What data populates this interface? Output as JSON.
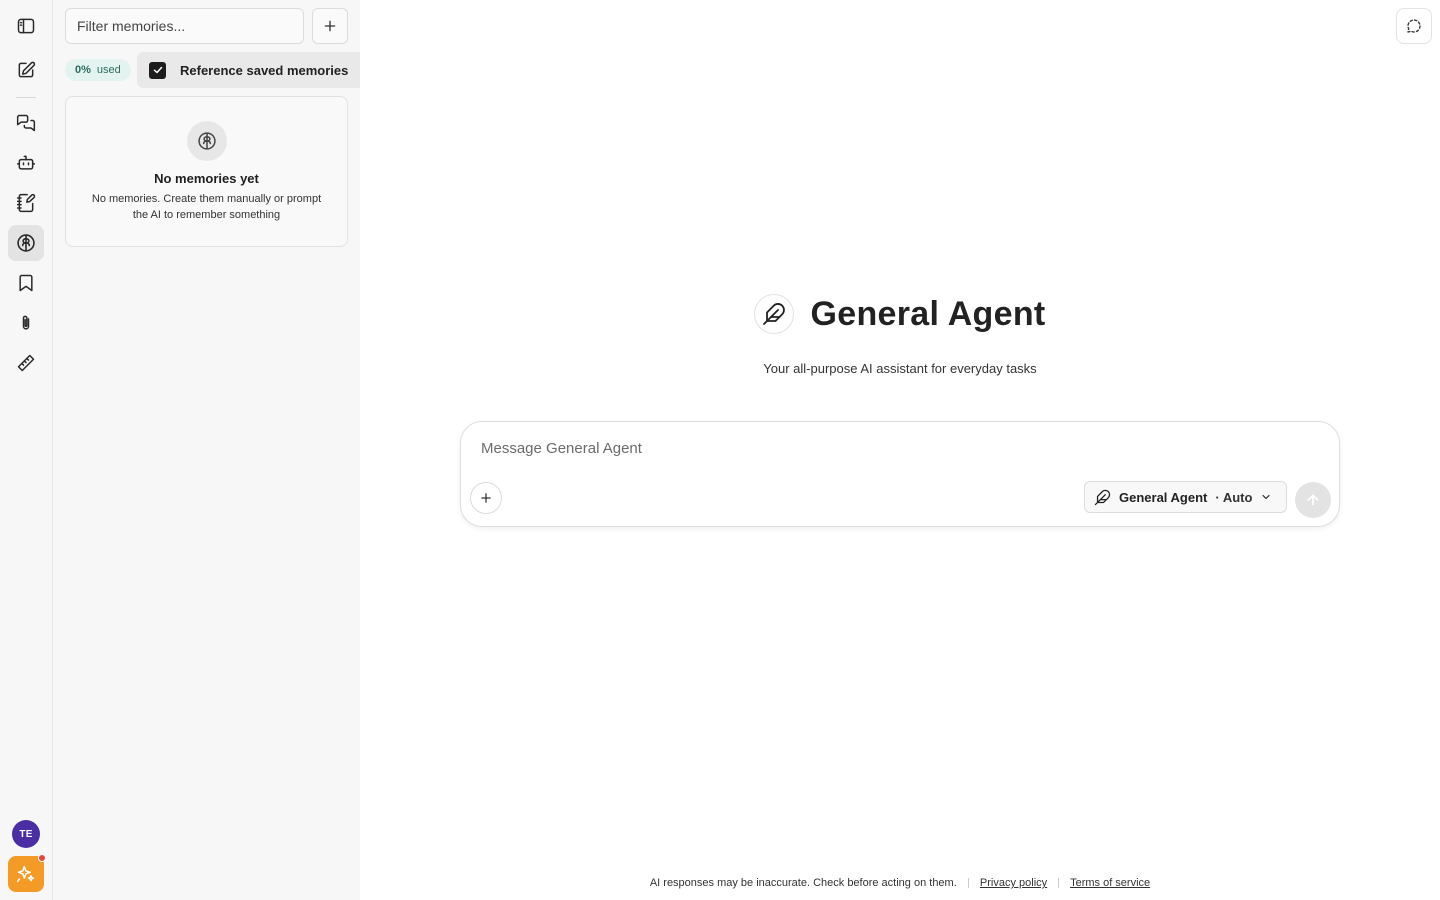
{
  "rail": {
    "items": [
      {
        "icon": "sidebar-toggle-icon"
      },
      {
        "icon": "new-chat-icon"
      },
      {
        "icon": "chats-icon"
      },
      {
        "icon": "bot-icon"
      },
      {
        "icon": "notebook-icon"
      },
      {
        "icon": "brain-icon",
        "active": true
      },
      {
        "icon": "bookmark-icon"
      },
      {
        "icon": "paperclip-icon"
      },
      {
        "icon": "ruler-icon"
      }
    ],
    "avatar_initials": "TE"
  },
  "memories": {
    "filter_placeholder": "Filter memories...",
    "usage_percent": "0%",
    "usage_label": "used",
    "reference_label": "Reference saved memories",
    "reference_checked": true,
    "empty_title": "No memories yet",
    "empty_description": "No memories. Create them manually or prompt the AI to remember something"
  },
  "main": {
    "agent_title": "General Agent",
    "agent_subtitle": "Your all-purpose AI assistant for everyday tasks",
    "composer_placeholder": "Message General Agent",
    "agent_select_name": "General Agent",
    "agent_select_mode": "· Auto"
  },
  "footer": {
    "disclaimer": "AI responses may be inaccurate. Check before acting on them.",
    "privacy_link": "Privacy policy",
    "terms_link": "Terms of service"
  },
  "colors": {
    "avatar": "#4b2ea3",
    "spark_button": "#f39a27",
    "usage_badge_bg": "#e3f3ef",
    "usage_badge_text": "#2d6b5e"
  }
}
